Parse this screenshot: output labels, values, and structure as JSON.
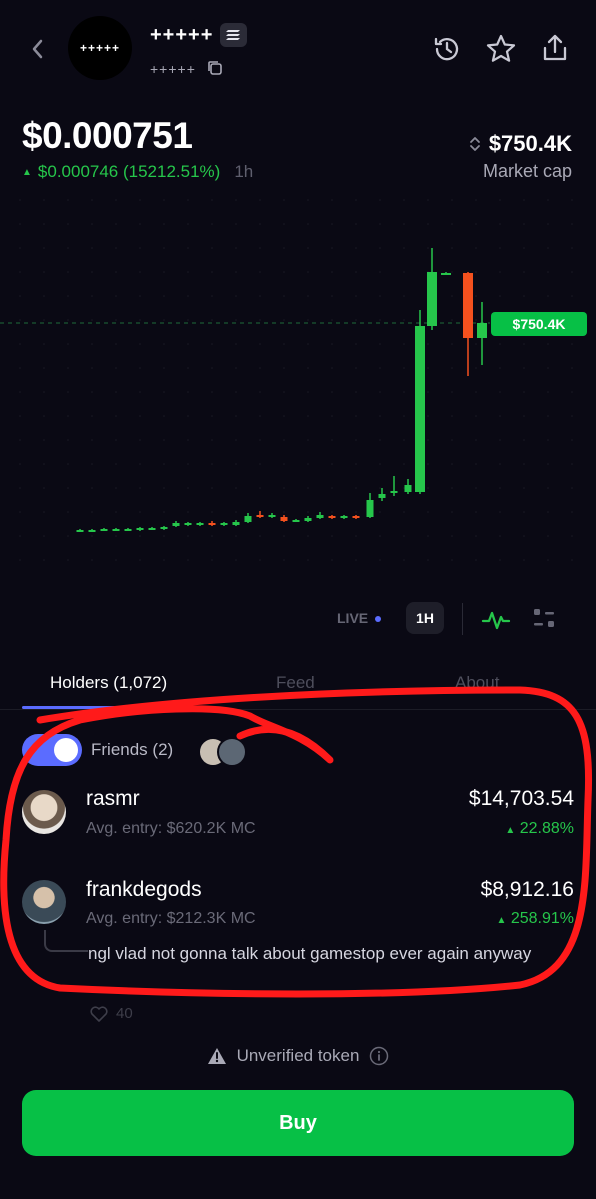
{
  "header": {
    "token_avatar_text": "+++++",
    "token_name": "+++++",
    "token_ticker": "+++++"
  },
  "price": {
    "value": "$0.000751",
    "change": "$0.000746 (15212.51%)",
    "timeframe": "1h",
    "market_cap_value": "$750.4K",
    "market_cap_label": "Market cap"
  },
  "chart": {
    "price_tag": "$750.4K"
  },
  "controls": {
    "live_label": "LIVE",
    "timeframe_button": "1H"
  },
  "tabs": [
    {
      "label": "Holders (1,072)"
    },
    {
      "label": "Feed"
    },
    {
      "label": "About"
    }
  ],
  "friends": {
    "label": "Friends (2)"
  },
  "holders": [
    {
      "name": "rasmr",
      "avg_entry": "Avg. entry: $620.2K MC",
      "value": "$14,703.54",
      "pct": "22.88%"
    },
    {
      "name": "frankdegods",
      "avg_entry": "Avg. entry: $212.3K MC",
      "value": "$8,912.16",
      "pct": "258.91%",
      "comment": "ngl vlad not gonna talk about gamestop ever again anyway",
      "likes": "40"
    }
  ],
  "footer": {
    "unverified_label": "Unverified token",
    "buy_label": "Buy"
  },
  "colors": {
    "accent": "#5b6cff",
    "up": "#26c64b",
    "down": "#f4511e",
    "buy": "#07c046"
  }
}
